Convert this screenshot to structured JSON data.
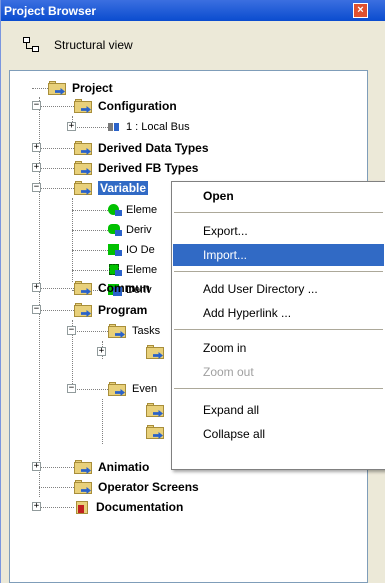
{
  "window": {
    "title": "Project Browser",
    "close_glyph": "×"
  },
  "toolbar": {
    "view_label": "Structural view",
    "view_icon": "tree-structure-icon"
  },
  "tree": {
    "project": "Project",
    "configuration": "Configuration",
    "local_bus": "1 : Local Bus",
    "derived_data_types": "Derived Data Types",
    "derived_fb_types": "Derived FB Types",
    "variables": "Variable",
    "var_items": [
      "Eleme",
      "Deriv",
      "IO De",
      "Eleme",
      "Deriv"
    ],
    "communication": "Commun",
    "program": "Program",
    "tasks": "Tasks",
    "events": "Even",
    "animation": "Animatio",
    "operator_screens": "Operator Screens",
    "documentation": "Documentation"
  },
  "context_menu": {
    "open": "Open",
    "export": "Export...",
    "import": "Import...",
    "add_user_directory": "Add User Directory ...",
    "add_hyperlink": "Add Hyperlink ...",
    "zoom_in": "Zoom in",
    "zoom_out": "Zoom out",
    "expand_all": "Expand all",
    "collapse_all": "Collapse all"
  },
  "colors": {
    "selection": "#316ac5",
    "titlebar": "#0a4ccf",
    "folder": "#e8d07a",
    "green_icon": "#00c000"
  }
}
